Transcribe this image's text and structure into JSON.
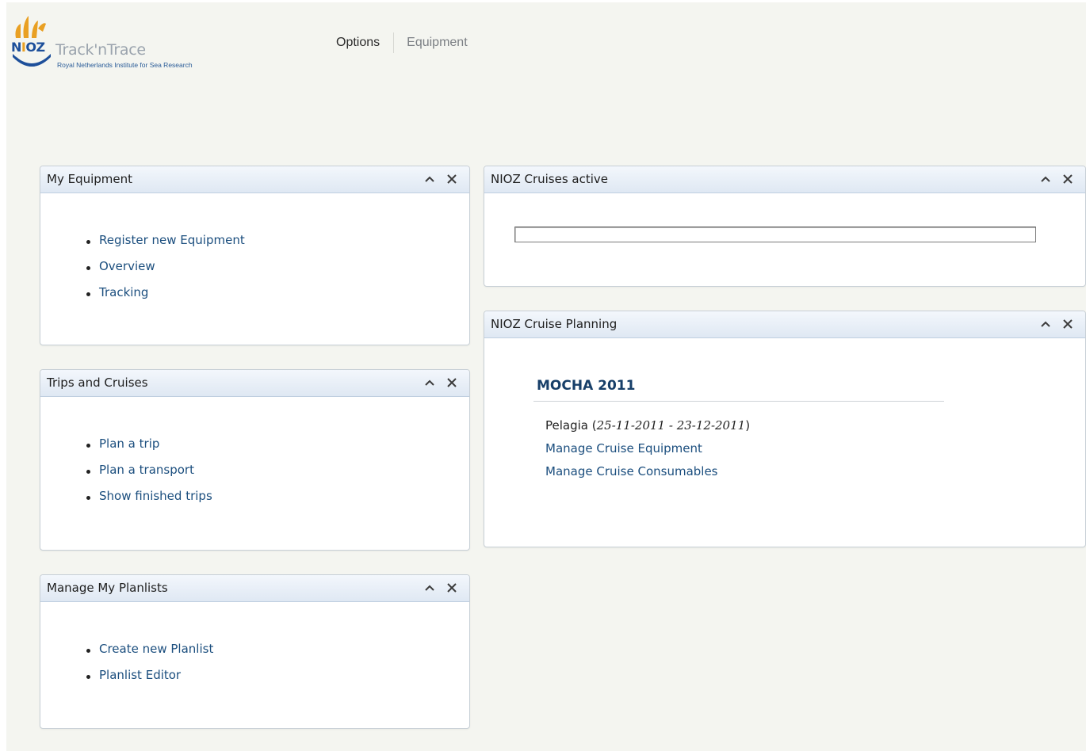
{
  "header": {
    "logo_brand": "NIOZ",
    "app_title": "Track'nTrace",
    "subtitle": "Royal Netherlands Institute for Sea Research",
    "nav": [
      "Options",
      "Equipment"
    ]
  },
  "widgets": {
    "my_equipment": {
      "title": "My Equipment",
      "items": [
        "Register new Equipment",
        "Overview",
        "Tracking"
      ]
    },
    "trips_cruises": {
      "title": "Trips and Cruises",
      "items": [
        "Plan a trip",
        "Plan a transport",
        "Show finished trips"
      ]
    },
    "planlists": {
      "title": "Manage My Planlists",
      "items": [
        "Create new Planlist",
        "Planlist Editor"
      ]
    },
    "cruises_active": {
      "title": "NIOZ Cruises active",
      "input_value": ""
    },
    "cruise_planning": {
      "title": "NIOZ Cruise Planning",
      "cruise_name": "MOCHA 2011",
      "ship": "Pelagia",
      "dates": "25-11-2011 - 23-12-2011",
      "links": [
        "Manage Cruise Equipment",
        "Manage Cruise Consumables"
      ]
    }
  },
  "colors": {
    "page_bg": "#f4f5f0",
    "link": "#1b4e7e",
    "header_gradient_top": "#f3f7fc",
    "header_gradient_bottom": "#dfe8f3",
    "logo_blue": "#1d4f9a",
    "logo_orange": "#e9a023"
  },
  "icons": [
    "nioz-logo-icon",
    "collapse-chevron-icon",
    "close-x-icon"
  ]
}
